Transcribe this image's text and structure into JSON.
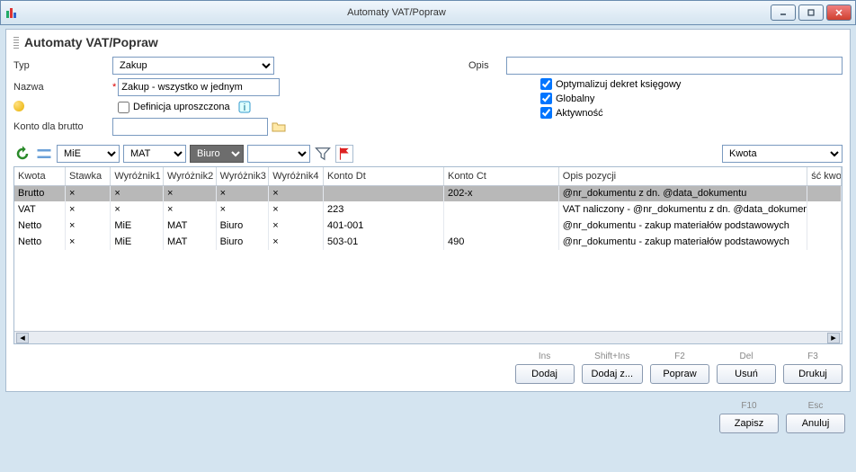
{
  "window": {
    "title": "Automaty VAT/Popraw"
  },
  "panel": {
    "title": "Automaty VAT/Popraw"
  },
  "labels": {
    "typ": "Typ",
    "nazwa": "Nazwa",
    "konto_brutto": "Konto dla brutto",
    "opis": "Opis",
    "def_upr": "Definicja uproszczona",
    "opt_dekret": "Optymalizuj dekret księgowy",
    "globalny": "Globalny",
    "aktywnosc": "Aktywność"
  },
  "form": {
    "typ": "Zakup",
    "nazwa": "Zakup - wszystko w jednym",
    "konto_brutto": "",
    "opis": "",
    "def_upr": false,
    "opt_dekret": true,
    "globalny": true,
    "aktywnosc": true
  },
  "toolbar": {
    "dd1": "MiE",
    "dd2": "MAT",
    "dd3": "Biuro",
    "dd4": "",
    "dd_right": "Kwota"
  },
  "grid": {
    "headers": {
      "kwota": "Kwota",
      "stawka": "Stawka",
      "w1": "Wyróżnik1",
      "w2": "Wyróżnik2",
      "w3": "Wyróżnik3",
      "w4": "Wyróżnik4",
      "konto_dt": "Konto Dt",
      "konto_ct": "Konto Ct",
      "opis_pozycji": "Opis pozycji",
      "sc_kwot": "ść kwot"
    },
    "rows": [
      {
        "kwota": "Brutto",
        "stawka": "×",
        "w1": "×",
        "w2": "×",
        "w3": "×",
        "w4": "×",
        "dt": "",
        "ct": "202-x",
        "opis": "@nr_dokumentu z dn. @data_dokumentu",
        "selected": true
      },
      {
        "kwota": "VAT",
        "stawka": "×",
        "w1": "×",
        "w2": "×",
        "w3": "×",
        "w4": "×",
        "dt": "223",
        "ct": "",
        "opis": "VAT naliczony - @nr_dokumentu z dn. @data_dokument",
        "selected": false
      },
      {
        "kwota": "Netto",
        "stawka": "×",
        "w1": "MiE",
        "w2": "MAT",
        "w3": "Biuro",
        "w4": "×",
        "dt": "401-001",
        "ct": "",
        "opis": "@nr_dokumentu - zakup materiałów podstawowych",
        "selected": false
      },
      {
        "kwota": "Netto",
        "stawka": "×",
        "w1": "MiE",
        "w2": "MAT",
        "w3": "Biuro",
        "w4": "×",
        "dt": "503-01",
        "ct": "490",
        "opis": "@nr_dokumentu - zakup materiałów podstawowych",
        "selected": false
      }
    ]
  },
  "buttons": {
    "dodaj": {
      "key": "Ins",
      "label": "Dodaj"
    },
    "dodajz": {
      "key": "Shift+Ins",
      "label": "Dodaj z..."
    },
    "popraw": {
      "key": "F2",
      "label": "Popraw"
    },
    "usun": {
      "key": "Del",
      "label": "Usuń"
    },
    "drukuj": {
      "key": "F3",
      "label": "Drukuj"
    },
    "zapisz": {
      "key": "F10",
      "label": "Zapisz"
    },
    "anuluj": {
      "key": "Esc",
      "label": "Anuluj"
    }
  }
}
